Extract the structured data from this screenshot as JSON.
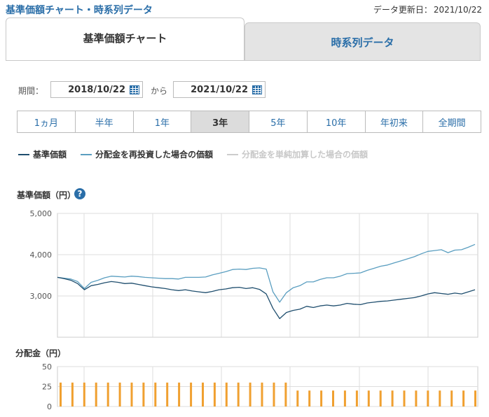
{
  "header": {
    "page_title": "基準価額チャート・時系列データ",
    "updated_label": "データ更新日：",
    "updated_date": "2021/10/22"
  },
  "tabs": [
    {
      "label": "基準価額チャート",
      "active": true
    },
    {
      "label": "時系列データ",
      "active": false
    }
  ],
  "period_range": {
    "label": "期間：",
    "start": "2018/10/22",
    "separator": "から",
    "end": "2021/10/22"
  },
  "period_buttons": [
    {
      "label": "1ヵ月",
      "active": false
    },
    {
      "label": "半年",
      "active": false
    },
    {
      "label": "1年",
      "active": false
    },
    {
      "label": "3年",
      "active": true
    },
    {
      "label": "5年",
      "active": false
    },
    {
      "label": "10年",
      "active": false
    },
    {
      "label": "年初来",
      "active": false
    },
    {
      "label": "全期間",
      "active": false
    }
  ],
  "legend": [
    {
      "label": "基準価額",
      "color": "#1f4e6e",
      "enabled": true
    },
    {
      "label": "分配金を再投資した場合の価額",
      "color": "#5a9ec0",
      "enabled": true
    },
    {
      "label": "分配金を単純加算した場合の価額",
      "color": "#cccccc",
      "enabled": false
    }
  ],
  "colors": {
    "nav_line": "#1f4e6e",
    "reinvest_line": "#5a9ec0",
    "dividend_bar": "#f0a030",
    "accent": "#2a6ea8"
  },
  "chart_data": [
    {
      "type": "line",
      "title": "",
      "ylabel": "基準価額（円）",
      "ylim": [
        2000,
        5000
      ],
      "yticks": [
        "5,000",
        "4,000",
        "3,000"
      ],
      "x_range": [
        "2018/10/22",
        "2021/10/22"
      ],
      "grid": true,
      "series": [
        {
          "name": "基準価額",
          "values": [
            3450,
            3420,
            3380,
            3300,
            3150,
            3250,
            3280,
            3320,
            3350,
            3330,
            3300,
            3310,
            3280,
            3250,
            3220,
            3200,
            3180,
            3150,
            3130,
            3150,
            3120,
            3100,
            3080,
            3110,
            3150,
            3170,
            3200,
            3210,
            3180,
            3200,
            3160,
            3050,
            2700,
            2450,
            2600,
            2650,
            2680,
            2750,
            2720,
            2760,
            2780,
            2760,
            2780,
            2820,
            2800,
            2790,
            2830,
            2850,
            2870,
            2880,
            2900,
            2920,
            2940,
            2960,
            3000,
            3050,
            3080,
            3060,
            3040,
            3070,
            3050,
            3100,
            3150
          ]
        },
        {
          "name": "分配金を再投資した場合の価額",
          "values": [
            3450,
            3430,
            3410,
            3350,
            3180,
            3330,
            3380,
            3440,
            3480,
            3470,
            3460,
            3480,
            3470,
            3450,
            3440,
            3430,
            3420,
            3420,
            3410,
            3450,
            3450,
            3450,
            3460,
            3510,
            3550,
            3590,
            3640,
            3650,
            3640,
            3670,
            3680,
            3650,
            3100,
            2850,
            3080,
            3200,
            3250,
            3340,
            3340,
            3400,
            3440,
            3440,
            3480,
            3540,
            3550,
            3560,
            3620,
            3670,
            3720,
            3750,
            3800,
            3850,
            3900,
            3950,
            4020,
            4080,
            4100,
            4120,
            4050,
            4110,
            4120,
            4180,
            4250
          ]
        }
      ]
    },
    {
      "type": "bar",
      "title": "",
      "ylabel": "分配金（円）",
      "ylim": [
        0,
        50
      ],
      "yticks": [
        "50",
        "25",
        "0"
      ],
      "values": [
        30,
        30,
        30,
        30,
        30,
        30,
        30,
        30,
        30,
        30,
        30,
        30,
        30,
        30,
        30,
        30,
        30,
        30,
        30,
        30,
        20,
        20,
        20,
        20,
        20,
        20,
        20,
        20,
        20,
        20,
        20,
        20,
        20,
        20,
        20,
        20
      ]
    }
  ]
}
